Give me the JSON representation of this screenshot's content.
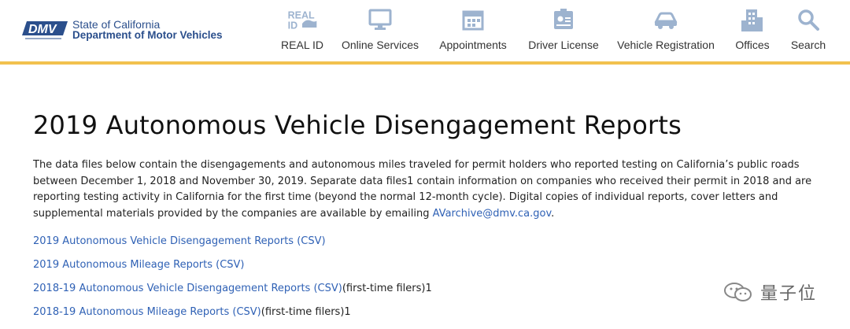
{
  "header": {
    "logo": {
      "line1": "State of California",
      "line2": "Department of Motor Vehicles",
      "mark_text": "DMV"
    },
    "nav": [
      {
        "label": "REAL ID",
        "icon": "real-id-icon"
      },
      {
        "label": "Online Services",
        "icon": "monitor-icon"
      },
      {
        "label": "Appointments",
        "icon": "calendar-icon"
      },
      {
        "label": "Driver License",
        "icon": "id-card-icon"
      },
      {
        "label": "Vehicle Registration",
        "icon": "car-icon"
      },
      {
        "label": "Offices",
        "icon": "building-icon"
      },
      {
        "label": "Search",
        "icon": "search-icon"
      }
    ],
    "accent_color": "#f2c14e"
  },
  "main": {
    "title": "2019 Autonomous Vehicle Disengagement Reports",
    "intro_text": "The data files below contain the disengagements and autonomous miles traveled for permit holders who reported testing on California’s public roads between December 1, 2018 and November 30, 2019. Separate data files1 contain information on companies who received their permit in 2018 and are reporting testing activity in California for the first time (beyond the normal 12-month cycle). Digital copies of individual reports, cover letters and supplemental materials provided by the companies are available by emailing ",
    "intro_email": "AVarchive@dmv.ca.gov",
    "intro_end": ".",
    "links": [
      {
        "text": "2019 Autonomous Vehicle Disengagement Reports (CSV)",
        "suffix": ""
      },
      {
        "text": "2019 Autonomous Mileage Reports (CSV)",
        "suffix": ""
      },
      {
        "text": "2018-19 Autonomous Vehicle Disengagement Reports (CSV)",
        "suffix": "(first-time filers)1"
      },
      {
        "text": "2018-19 Autonomous Mileage Reports (CSV)",
        "suffix": "(first-time filers)1"
      }
    ],
    "link_color": "#2f61b5"
  },
  "watermark": {
    "text": "量子位"
  }
}
